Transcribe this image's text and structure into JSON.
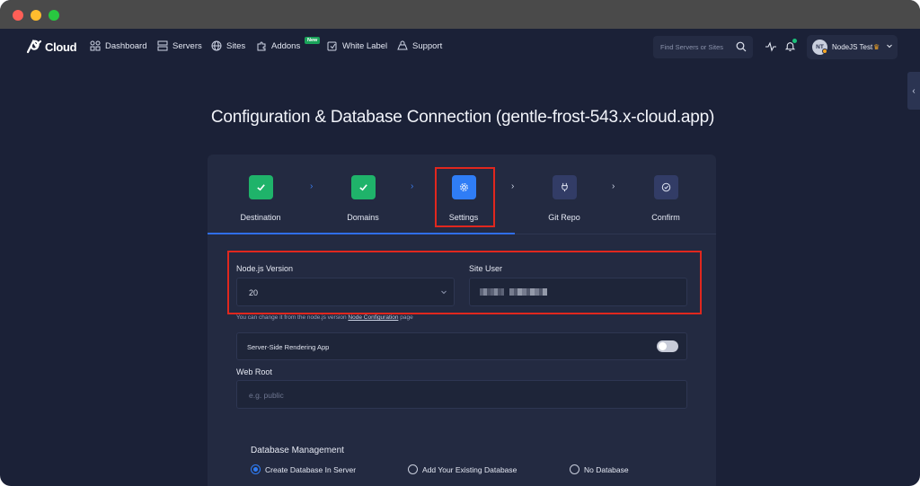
{
  "app": {
    "logo_text": "Cloud"
  },
  "nav": {
    "items": [
      {
        "label": "Dashboard",
        "icon": "dashboard-icon"
      },
      {
        "label": "Servers",
        "icon": "servers-icon"
      },
      {
        "label": "Sites",
        "icon": "globe-icon"
      },
      {
        "label": "Addons",
        "icon": "puzzle-icon",
        "badge": "New"
      },
      {
        "label": "White Label",
        "icon": "white-label-icon"
      },
      {
        "label": "Support",
        "icon": "support-icon"
      }
    ],
    "search_placeholder": "Find Servers or Sites",
    "user": {
      "initials": "NT",
      "name": "NodeJS Test",
      "crown": "♛"
    }
  },
  "page": {
    "title": "Configuration & Database Connection (gentle-frost-543.x-cloud.app)"
  },
  "steps": [
    {
      "label": "Destination",
      "state": "done"
    },
    {
      "label": "Domains",
      "state": "done"
    },
    {
      "label": "Settings",
      "state": "active"
    },
    {
      "label": "Git Repo",
      "state": "todo"
    },
    {
      "label": "Confirm",
      "state": "todo"
    }
  ],
  "form": {
    "node_version_label": "Node.js Version",
    "node_version_value": "20",
    "site_user_label": "Site User",
    "hint_prefix": "You can change it from the node.js version ",
    "hint_link": "Node Configuration",
    "hint_suffix": " page",
    "ssr_label": "Server-Side Rendering App",
    "ssr_enabled": false,
    "web_root_label": "Web Root",
    "web_root_placeholder": "e.g. public"
  },
  "database": {
    "title": "Database Management",
    "options": [
      {
        "label": "Create Database In Server",
        "checked": true
      },
      {
        "label": "Add Your Existing Database",
        "checked": false
      },
      {
        "label": "No Database",
        "checked": false
      }
    ]
  },
  "colors": {
    "background": "#1b2137",
    "card": "#232a41",
    "accent": "#2f7df6",
    "success": "#1fb36a",
    "highlight": "#e0271e"
  }
}
